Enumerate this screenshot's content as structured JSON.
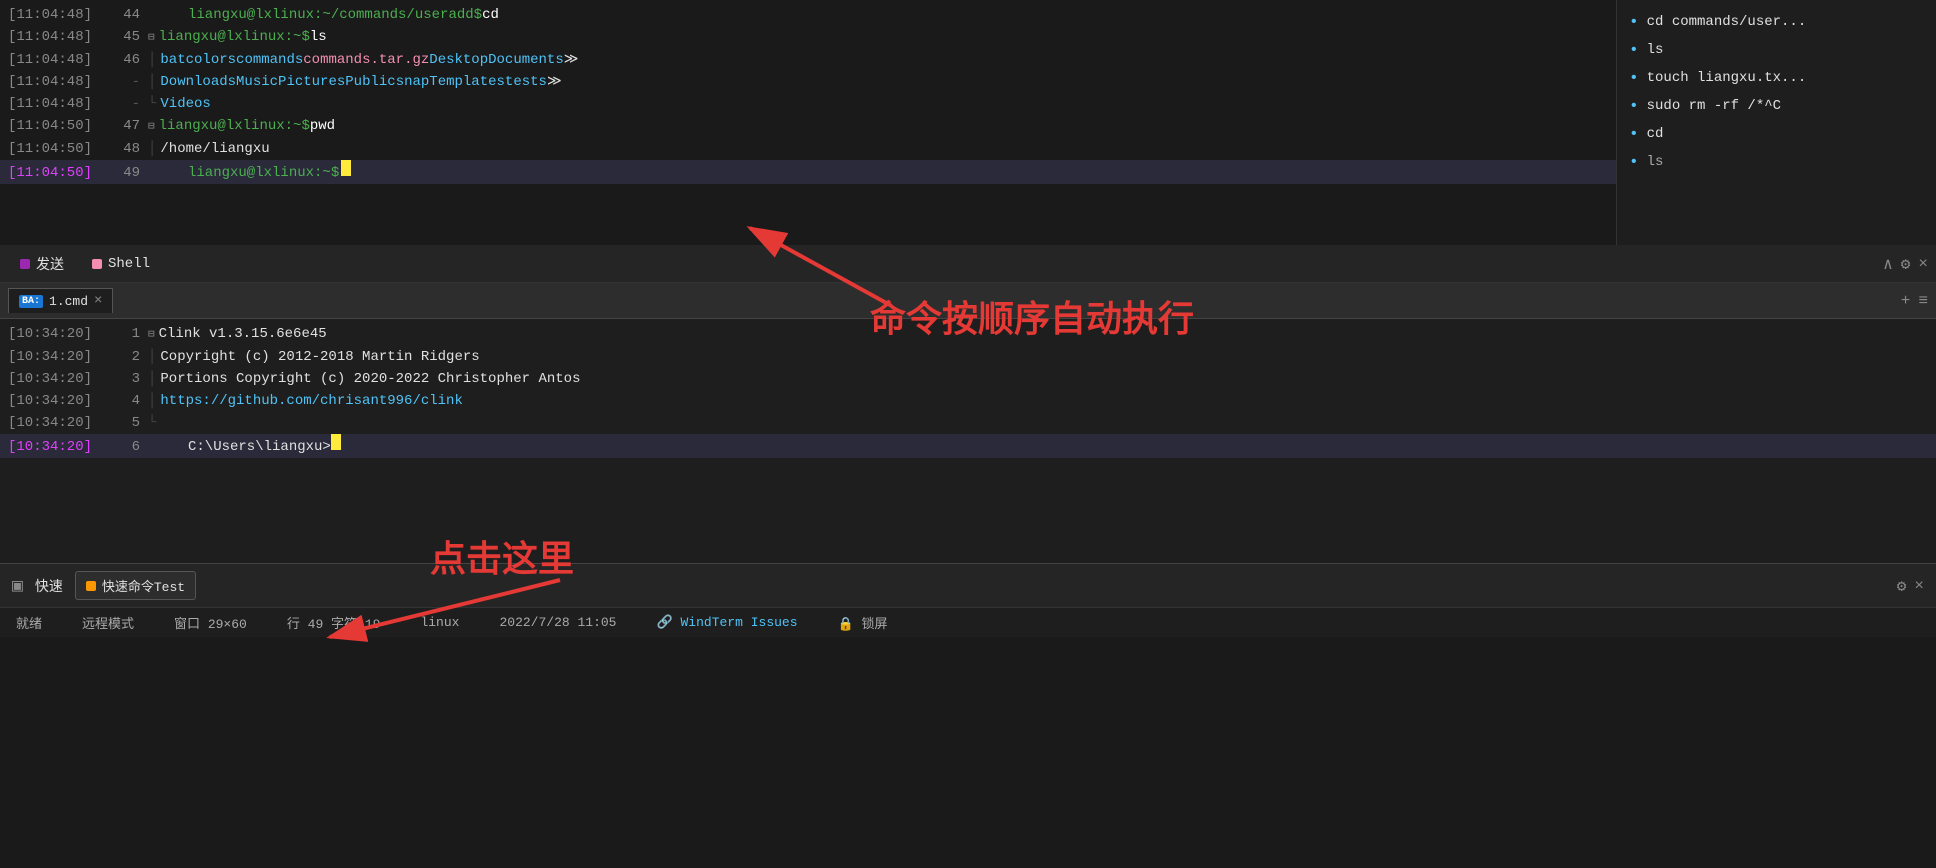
{
  "terminal_top": {
    "lines": [
      {
        "ts": "[11:04:48]",
        "ln": "44",
        "fold": "",
        "prompt": "liangxu@lxlinux:~/commands/useradd$",
        "cmd": " cd",
        "type": "cmd"
      },
      {
        "ts": "[11:04:48]",
        "ln": "45",
        "fold": "⊟",
        "prompt": "liangxu@lxlinux:~$",
        "cmd": " ls",
        "type": "cmd"
      },
      {
        "ts": "[11:04:48]",
        "ln": "46",
        "fold": "|",
        "content": "bat  colors  commands  commands.tar.gz  Desktop  Documents  ≫",
        "type": "files"
      },
      {
        "ts": "[11:04:48]",
        "ln": "-",
        "fold": "|",
        "content": "Downloads  Music  Pictures  Public  snap  Templates  tests  ≫",
        "type": "files2"
      },
      {
        "ts": "[11:04:48]",
        "ln": "-",
        "fold": "└",
        "content": "Videos",
        "type": "files3"
      },
      {
        "ts": "[11:04:50]",
        "ln": "47",
        "fold": "⊟",
        "prompt": "liangxu@lxlinux:~$",
        "cmd": " pwd",
        "type": "cmd"
      },
      {
        "ts": "[11:04:50]",
        "ln": "48",
        "fold": "|",
        "content": "/home/liangxu",
        "type": "plain"
      },
      {
        "ts": "[11:04:50]",
        "ln": "49",
        "fold": "",
        "prompt": "liangxu@lxlinux:~$",
        "cmd": "",
        "type": "active",
        "ts_pink": true
      }
    ]
  },
  "sidebar_right": {
    "items": [
      "cd commands/user...",
      "ls",
      "touch liangxu.tx...",
      "sudo rm -rf /*^C",
      "cd",
      "ls"
    ]
  },
  "tab_bar": {
    "send_label": "发送",
    "shell_label": "Shell",
    "icons": [
      "∧",
      "⚙",
      "×"
    ]
  },
  "cmd_terminal": {
    "tab_name": "1.cmd",
    "lines": [
      {
        "ts": "[10:34:20]",
        "ln": "1",
        "fold": "⊟",
        "content": "Clink v1.3.15.6e6e45",
        "type": "plain"
      },
      {
        "ts": "[10:34:20]",
        "ln": "2",
        "fold": "|",
        "content": "Copyright (c) 2012-2018 Martin Ridgers",
        "type": "plain"
      },
      {
        "ts": "[10:34:20]",
        "ln": "3",
        "fold": "|",
        "content": "Portions Copyright (c) 2020-2022 Christopher Antos",
        "type": "plain"
      },
      {
        "ts": "[10:34:20]",
        "ln": "4",
        "fold": "|",
        "content": "https://github.com/chrisant996/clink",
        "type": "link"
      },
      {
        "ts": "[10:34:20]",
        "ln": "5",
        "fold": "└",
        "content": "",
        "type": "plain"
      },
      {
        "ts": "[10:34:20]",
        "ln": "6",
        "fold": "",
        "content": "C:\\Users\\liangxu>",
        "type": "active_cmd",
        "ts_pink": true
      }
    ],
    "icons": [
      "+",
      "≡"
    ]
  },
  "annotation1": {
    "text": "命令按顺序自动执行"
  },
  "annotation2": {
    "text": "点击这里"
  },
  "quick_bar": {
    "icon": "▣",
    "label": "快速",
    "tab_label": "快速命令Test",
    "icons": [
      "⚙",
      "×"
    ]
  },
  "status_bar": {
    "ready": "就绪",
    "remote": "远程模式",
    "window": "窗口 29×60",
    "row": "行 49 字符 19",
    "os": "linux",
    "datetime": "2022/7/28  11:05",
    "issues_label": "WindTerm Issues",
    "lock_icon": "🔒",
    "lock_label": "锁屏"
  }
}
